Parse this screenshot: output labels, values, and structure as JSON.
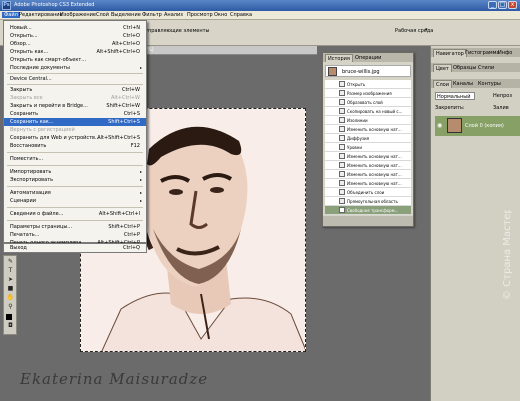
{
  "titlebar": {
    "title": "Adobe Photoshop CS3 Extended",
    "logo": "Ps",
    "min": "_",
    "max": "□",
    "close": "x"
  },
  "menubar": {
    "items": [
      "Файл",
      "Редактирование",
      "Изображение",
      "Слой",
      "Выделение",
      "Фильтр",
      "Анализ",
      "Просмотр",
      "Окно",
      "Справка"
    ]
  },
  "optbar": {
    "options_text": "управляющие элементы",
    "workspace_label": "Рабочая среда",
    "workspace_arrow": "▾"
  },
  "filemenu": {
    "items": [
      {
        "label": "Новый...",
        "shortcut": "Ctrl+N"
      },
      {
        "label": "Открыть...",
        "shortcut": "Ctrl+O"
      },
      {
        "label": "Обзор...",
        "shortcut": "Alt+Ctrl+O"
      },
      {
        "label": "Открыть как...",
        "shortcut": "Alt+Shift+Ctrl+O"
      },
      {
        "label": "Открыть как смарт-объект..."
      },
      {
        "label": "Последние документы"
      },
      {
        "label": "Device Central..."
      },
      {
        "label": "Закрыть",
        "shortcut": "Ctrl+W"
      },
      {
        "label": "Закрыть все",
        "shortcut": "Alt+Ctrl+W"
      },
      {
        "label": "Закрыть и перейти в Bridge...",
        "shortcut": "Shift+Ctrl+W"
      },
      {
        "label": "Сохранить",
        "shortcut": "Ctrl+S"
      },
      {
        "label": "Сохранить как...",
        "shortcut": "Shift+Ctrl+S"
      },
      {
        "label": "Вернуть с регистрацией"
      },
      {
        "label": "Сохранить для Web и устройств...",
        "shortcut": "Alt+Shift+Ctrl+S"
      },
      {
        "label": "Восстановить",
        "shortcut": "F12"
      },
      {
        "label": "Поместить..."
      },
      {
        "label": "Импортировать"
      },
      {
        "label": "Экспортировать"
      },
      {
        "label": "Автоматизация"
      },
      {
        "label": "Сценарии"
      },
      {
        "label": "Сведения о файле...",
        "shortcut": "Alt+Shift+Ctrl+I"
      },
      {
        "label": "Параметры страницы...",
        "shortcut": "Shift+Ctrl+P"
      },
      {
        "label": "Печатать...",
        "shortcut": "Ctrl+P"
      },
      {
        "label": "Печать одного экземпляра",
        "shortcut": "Alt+Shift+Ctrl+P"
      },
      {
        "label": "Выход",
        "shortcut": "Ctrl+Q"
      }
    ],
    "submenu_arrow": "▸"
  },
  "document": {
    "title": "%)"
  },
  "history": {
    "tabs": [
      "История",
      "Операции"
    ],
    "snapshot": "bruce-willis.jpg",
    "steps": [
      "Открыть",
      "Размер изображения",
      "Образовать слой",
      "Скопировать на новый с...",
      "Изолинии",
      "Изменить основную нат...",
      "Диффузия",
      "Уровни",
      "Изменить основную нат...",
      "Изменить основную нат...",
      "Изменить основную нат...",
      "Изменить основную нат...",
      "Объединить слои",
      "Прямоугольная область",
      "Свободное трансформ..."
    ]
  },
  "rpanel": {
    "top_tabs": [
      "Навигатор",
      "Гистограмма",
      "Инфо"
    ],
    "mid_tabs": [
      "Цвет",
      "Образцы",
      "Стили"
    ],
    "layer_tabs": [
      "Слои",
      "Каналы",
      "Контуры"
    ],
    "blend_mode": "Нормальный",
    "opacity_label": "Непроз",
    "lock_label": "Закрепить:",
    "fill_label": "Залив",
    "layer_name": "Слой 0 (копия)"
  },
  "watermark": {
    "text": "© Страна Мастеров"
  },
  "signature": {
    "text": "Ekaterina Maisuradze"
  }
}
